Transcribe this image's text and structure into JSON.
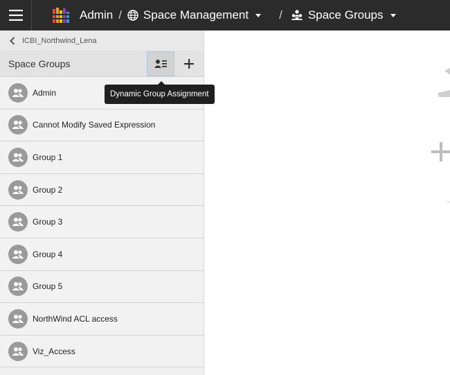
{
  "header": {
    "app_label": "Admin",
    "separator": "/",
    "space_management_label": "Space Management",
    "space_groups_label": "Space Groups",
    "menu_icon": "hamburger-icon",
    "logo_icon": "app-logo-icon",
    "globe_icon": "globe-icon",
    "groups_icon": "group-people-icon"
  },
  "sidebar": {
    "back_label": "ICBI_Northwind_Lena",
    "title": "Space Groups",
    "tools": {
      "assign_icon": "dynamic-assign-icon",
      "add_icon": "plus-icon"
    },
    "groups": [
      {
        "name": "Admin"
      },
      {
        "name": "Cannot Modify Saved Expression"
      },
      {
        "name": "Group 1"
      },
      {
        "name": "Group 2"
      },
      {
        "name": "Group 3"
      },
      {
        "name": "Group 4"
      },
      {
        "name": "Group 5"
      },
      {
        "name": "NorthWind ACL access"
      },
      {
        "name": "Viz_Access"
      }
    ]
  },
  "tooltip": {
    "text": "Dynamic Group Assignment"
  },
  "colors": {
    "topbar": "#2b2b2b",
    "panel": "#f0f0f0",
    "avatar": "#9a9a9a",
    "tooltip": "#1f1f1f"
  }
}
